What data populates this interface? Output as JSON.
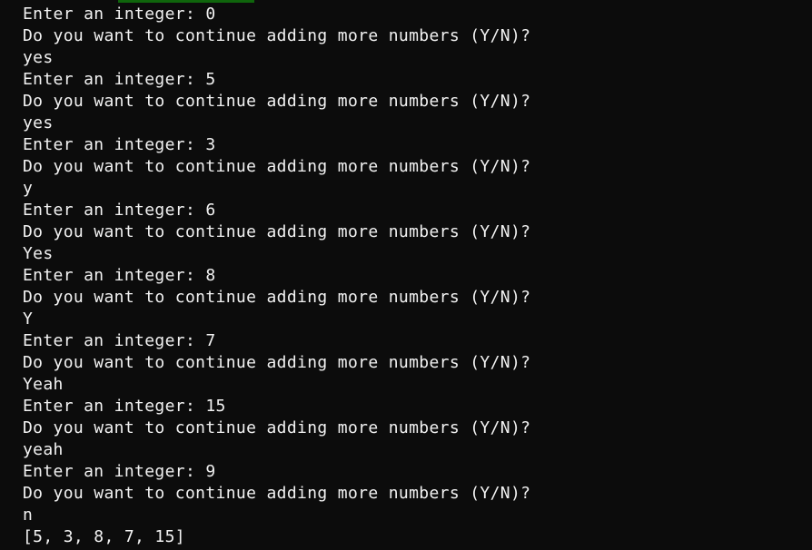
{
  "terminal": {
    "lines": [
      "Enter an integer: 0",
      "Do you want to continue adding more numbers (Y/N)?",
      "yes",
      "Enter an integer: 5",
      "Do you want to continue adding more numbers (Y/N)?",
      "yes",
      "Enter an integer: 3",
      "Do you want to continue adding more numbers (Y/N)?",
      "y",
      "Enter an integer: 6",
      "Do you want to continue adding more numbers (Y/N)?",
      "Yes",
      "Enter an integer: 8",
      "Do you want to continue adding more numbers (Y/N)?",
      "Y",
      "Enter an integer: 7",
      "Do you want to continue adding more numbers (Y/N)?",
      "Yeah",
      "Enter an integer: 15",
      "Do you want to continue adding more numbers (Y/N)?",
      "yeah",
      "Enter an integer: 9",
      "Do you want to continue adding more numbers (Y/N)?",
      "n",
      "[5, 3, 8, 7, 15]"
    ]
  },
  "colors": {
    "background": "#0c0c0c",
    "text": "#f2f2f2"
  }
}
